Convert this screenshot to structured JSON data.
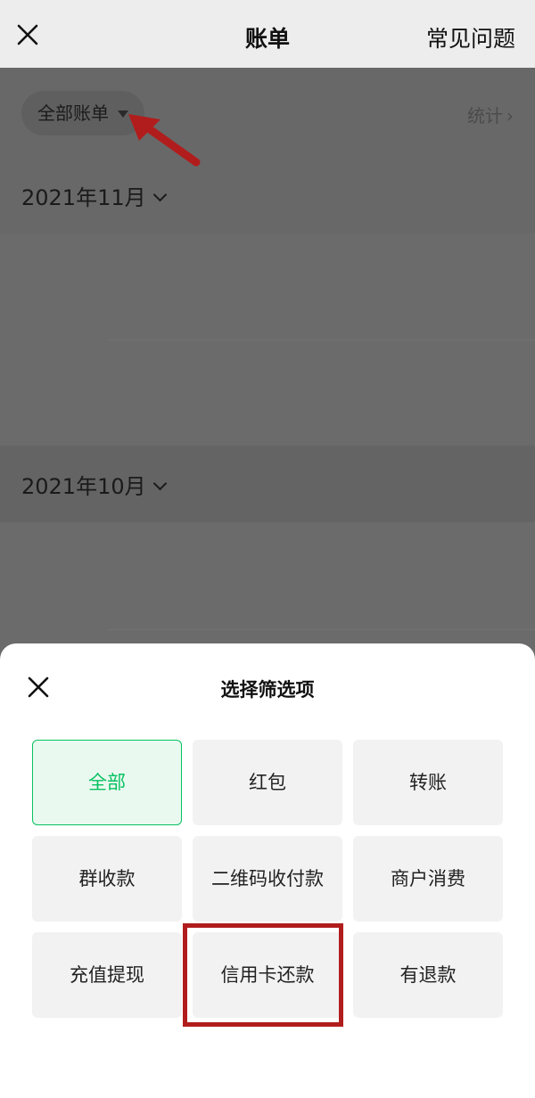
{
  "header": {
    "title": "账单",
    "faq_label": "常见问题"
  },
  "page": {
    "filter_label": "全部账单",
    "stats_label": "统计",
    "months": [
      "2021年11月",
      "2021年10月"
    ]
  },
  "sheet": {
    "title": "选择筛选项",
    "options": [
      "全部",
      "红包",
      "转账",
      "群收款",
      "二维码收付款",
      "商户消费",
      "充值提现",
      "信用卡还款",
      "有退款"
    ],
    "selected_option": "全部"
  },
  "colors": {
    "accent": "#07c160",
    "annotation": "#b11d1d"
  }
}
